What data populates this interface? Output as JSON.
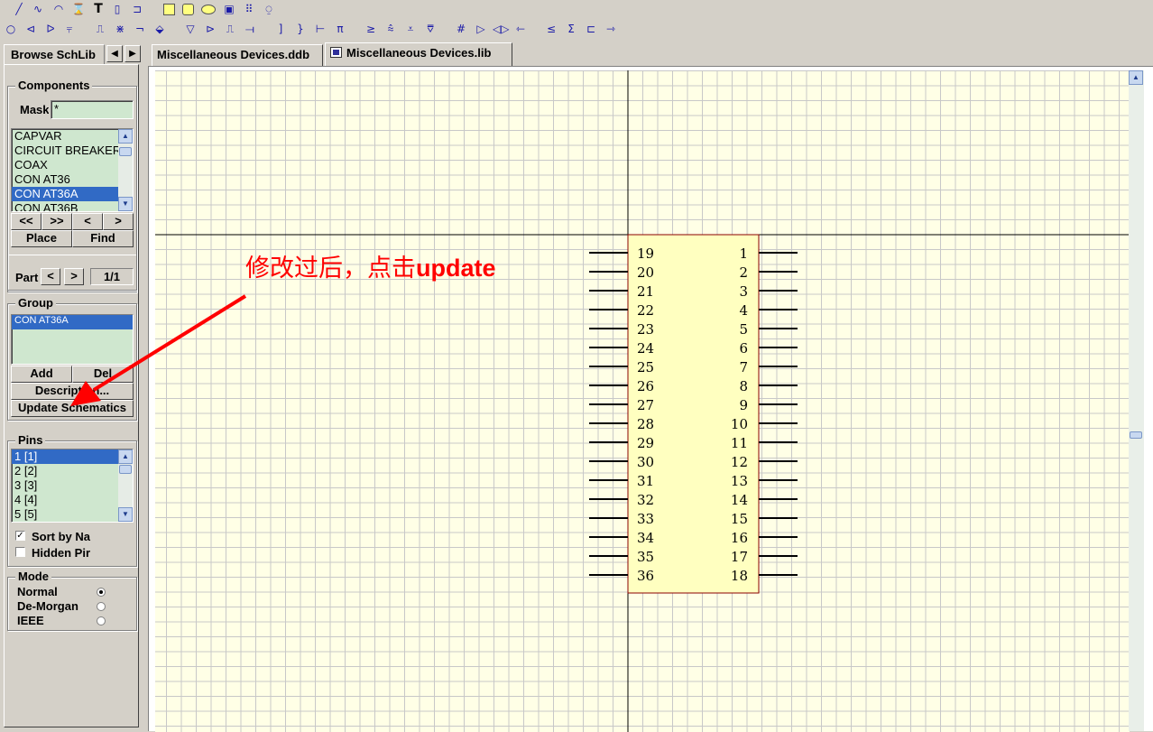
{
  "toolbar_row1": [
    {
      "name": "line-tool-icon",
      "glyph": "╱"
    },
    {
      "name": "bezier-tool-icon",
      "glyph": "∿"
    },
    {
      "name": "arc-tool-icon",
      "glyph": "◠"
    },
    {
      "name": "polygon-tool-icon",
      "glyph": "⌛"
    },
    {
      "name": "text-tool-icon",
      "glyph": "T"
    },
    {
      "name": "component-tool-icon",
      "glyph": "▯"
    },
    {
      "name": "pin-tool-icon",
      "glyph": "⊐"
    },
    {
      "name": "rectangle-tool-icon",
      "glyph": ""
    },
    {
      "name": "rounded-rectangle-tool-icon",
      "glyph": ""
    },
    {
      "name": "ellipse-tool-icon",
      "glyph": ""
    },
    {
      "name": "graphic-tool-icon",
      "glyph": "▣"
    },
    {
      "name": "array-tool-icon",
      "glyph": "⠿"
    },
    {
      "name": "ieee-tool-icon",
      "glyph": "⍜"
    }
  ],
  "toolbar_row2": [
    {
      "name": "dot-symbol-icon",
      "glyph": "○"
    },
    {
      "name": "left-arrow-symbol-icon",
      "glyph": "⊲"
    },
    {
      "name": "clock-symbol-icon",
      "glyph": "ᐅ"
    },
    {
      "name": "active-low-input-icon",
      "glyph": "⫧"
    },
    {
      "name": "analog-signal-icon",
      "glyph": "⎍"
    },
    {
      "name": "not-logic-icon",
      "glyph": "⋇"
    },
    {
      "name": "postponed-output-icon",
      "glyph": "¬"
    },
    {
      "name": "open-collector-icon",
      "glyph": "⬙"
    },
    {
      "name": "hiz-icon",
      "glyph": "▽"
    },
    {
      "name": "high-current-icon",
      "glyph": "⊳"
    },
    {
      "name": "pulse-icon",
      "glyph": "⎍"
    },
    {
      "name": "delay-icon",
      "glyph": "⟞"
    },
    {
      "name": "group-line-icon",
      "glyph": "]"
    },
    {
      "name": "group-binary-icon",
      "glyph": "}"
    },
    {
      "name": "active-low-output-icon",
      "glyph": "⊢"
    },
    {
      "name": "pi-symbol-icon",
      "glyph": "π"
    },
    {
      "name": "greater-equal-icon",
      "glyph": "≥"
    },
    {
      "name": "open-collector-pullup-icon",
      "glyph": "⩯"
    },
    {
      "name": "open-emitter-icon",
      "glyph": "⩡"
    },
    {
      "name": "open-emitter-pullup-icon",
      "glyph": "⩢"
    },
    {
      "name": "digital-signal-icon",
      "glyph": "#"
    },
    {
      "name": "invertor-icon",
      "glyph": "▷"
    },
    {
      "name": "input-output-icon",
      "glyph": "◁▷"
    },
    {
      "name": "shift-left-icon",
      "glyph": "⇽"
    },
    {
      "name": "less-equal-icon",
      "glyph": "≤"
    },
    {
      "name": "sigma-icon",
      "glyph": "Σ"
    },
    {
      "name": "schmitt-icon",
      "glyph": "⊏"
    },
    {
      "name": "shift-right-icon",
      "glyph": "⇾"
    }
  ],
  "left_panel": {
    "tab_label": "Browse SchLib",
    "tab_prev": "◀",
    "tab_next": "▶",
    "components": {
      "title": "Components",
      "mask_label": "Mask",
      "mask_value": "*",
      "items": [
        "CAPVAR",
        "CIRCUIT BREAKER",
        "COAX",
        "CON AT36",
        "CON AT36A",
        "CON AT36B"
      ],
      "selected_index": 4,
      "nav_first": "<<",
      "nav_last": ">>",
      "nav_prev": "<",
      "nav_next": ">",
      "place_label": "Place",
      "find_label": "Find"
    },
    "part": {
      "label": "Part",
      "prev": "<",
      "next": ">",
      "value": "1/1"
    },
    "group": {
      "title": "Group",
      "items": [
        "CON AT36A"
      ],
      "add_label": "Add",
      "del_label": "Del",
      "description_label": "Description...",
      "update_label": "Update Schematics"
    },
    "pins": {
      "title": "Pins",
      "items": [
        "1  [1]",
        "2  [2]",
        "3  [3]",
        "4  [4]",
        "5  [5]"
      ],
      "sort_label": "Sort by Na",
      "sort_checked": "✓",
      "hidden_label": "Hidden Pir",
      "hidden_checked": ""
    },
    "mode": {
      "title": "Mode",
      "options": [
        "Normal",
        "De-Morgan",
        "IEEE"
      ],
      "selected_index": 0
    }
  },
  "doc_tabs": [
    {
      "label": "Miscellaneous Devices.ddb",
      "active": false
    },
    {
      "label": "Miscellaneous Devices.lib",
      "active": true
    }
  ],
  "component": {
    "left_pins": [
      "19",
      "20",
      "21",
      "22",
      "23",
      "24",
      "25",
      "26",
      "27",
      "28",
      "29",
      "30",
      "31",
      "32",
      "33",
      "34",
      "35",
      "36"
    ],
    "right_pins": [
      "1",
      "2",
      "3",
      "4",
      "5",
      "6",
      "7",
      "8",
      "9",
      "10",
      "11",
      "12",
      "13",
      "14",
      "15",
      "16",
      "17",
      "18"
    ],
    "body_fill": "#ffffc0",
    "body_border": "#8b0000"
  },
  "colors": {
    "grid_background": "#ffffe6",
    "grid_lines": "#c8c8c8",
    "annotation": "#ff0000",
    "selection": "#316ac5",
    "list_background": "#cfe7cf"
  },
  "annotation": {
    "text_cn": "修改过后，点击",
    "text_latin": "update"
  }
}
